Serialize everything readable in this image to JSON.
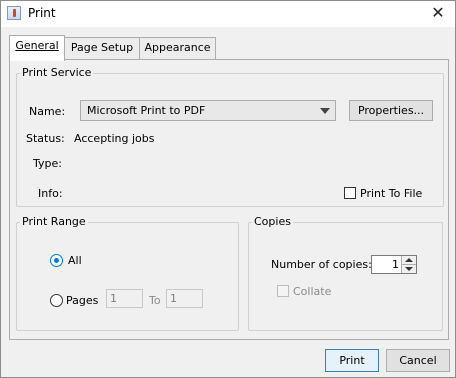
{
  "window": {
    "title": "Print"
  },
  "tabs": [
    {
      "label": "General",
      "active": true
    },
    {
      "label": "Page Setup",
      "active": false
    },
    {
      "label": "Appearance",
      "active": false
    }
  ],
  "print_service": {
    "title": "Print Service",
    "name_label": "Name:",
    "printer": "Microsoft Print to PDF",
    "properties_label": "Properties...",
    "status_label": "Status:",
    "status_value": "Accepting jobs",
    "type_label": "Type:",
    "type_value": "",
    "info_label": "Info:",
    "info_value": "",
    "print_to_file_label": "Print To File",
    "print_to_file_checked": false
  },
  "print_range": {
    "title": "Print Range",
    "all_label": "All",
    "all_selected": true,
    "pages_label": "Pages",
    "pages_from": "1",
    "to_label": "To",
    "pages_to": "1"
  },
  "copies": {
    "title": "Copies",
    "number_label": "Number of copies:",
    "number_value": "1",
    "collate_label": "Collate",
    "collate_enabled": false
  },
  "buttons": {
    "print": "Print",
    "cancel": "Cancel"
  },
  "colors": {
    "accent": "#0078d7",
    "default_button_border": "#3c7fb1",
    "panel_bg": "#f0f0f0"
  }
}
